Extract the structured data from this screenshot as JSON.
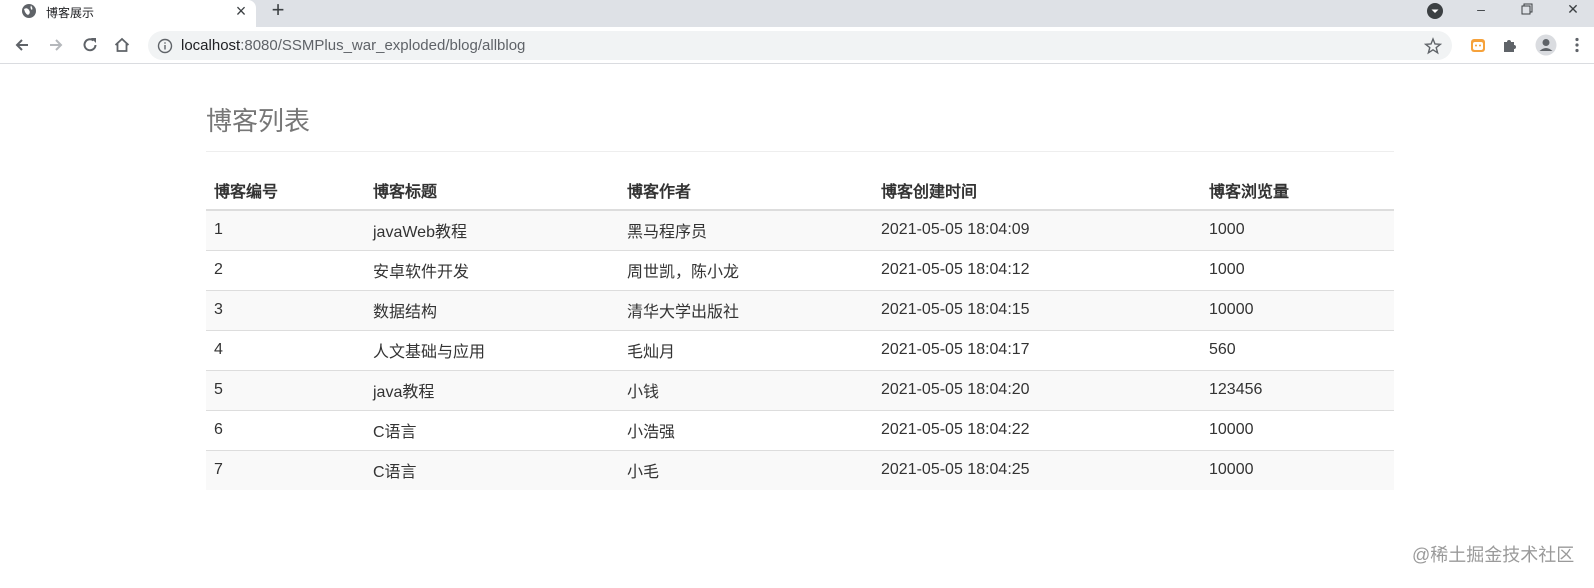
{
  "browser": {
    "tab_title": "博客展示",
    "new_tab_label": "+",
    "url_host": "localhost",
    "url_rest": ":8080/SSMPlus_war_exploded/blog/allblog"
  },
  "page": {
    "title": "博客列表"
  },
  "table": {
    "headers": [
      "博客编号",
      "博客标题",
      "博客作者",
      "博客创建时间",
      "博客浏览量"
    ],
    "rows": [
      [
        "1",
        "javaWeb教程",
        "黑马程序员",
        "2021-05-05 18:04:09",
        "1000"
      ],
      [
        "2",
        "安卓软件开发",
        "周世凯，陈小龙",
        "2021-05-05 18:04:12",
        "1000"
      ],
      [
        "3",
        "数据结构",
        "清华大学出版社",
        "2021-05-05 18:04:15",
        "10000"
      ],
      [
        "4",
        "人文基础与应用",
        "毛灿月",
        "2021-05-05 18:04:17",
        "560"
      ],
      [
        "5",
        "java教程",
        "小钱",
        "2021-05-05 18:04:20",
        "123456"
      ],
      [
        "6",
        "C语言",
        "小浩强",
        "2021-05-05 18:04:22",
        "10000"
      ],
      [
        "7",
        "C语言",
        "小毛",
        "2021-05-05 18:04:25",
        "10000"
      ]
    ]
  },
  "watermark": "@稀土掘金技术社区"
}
